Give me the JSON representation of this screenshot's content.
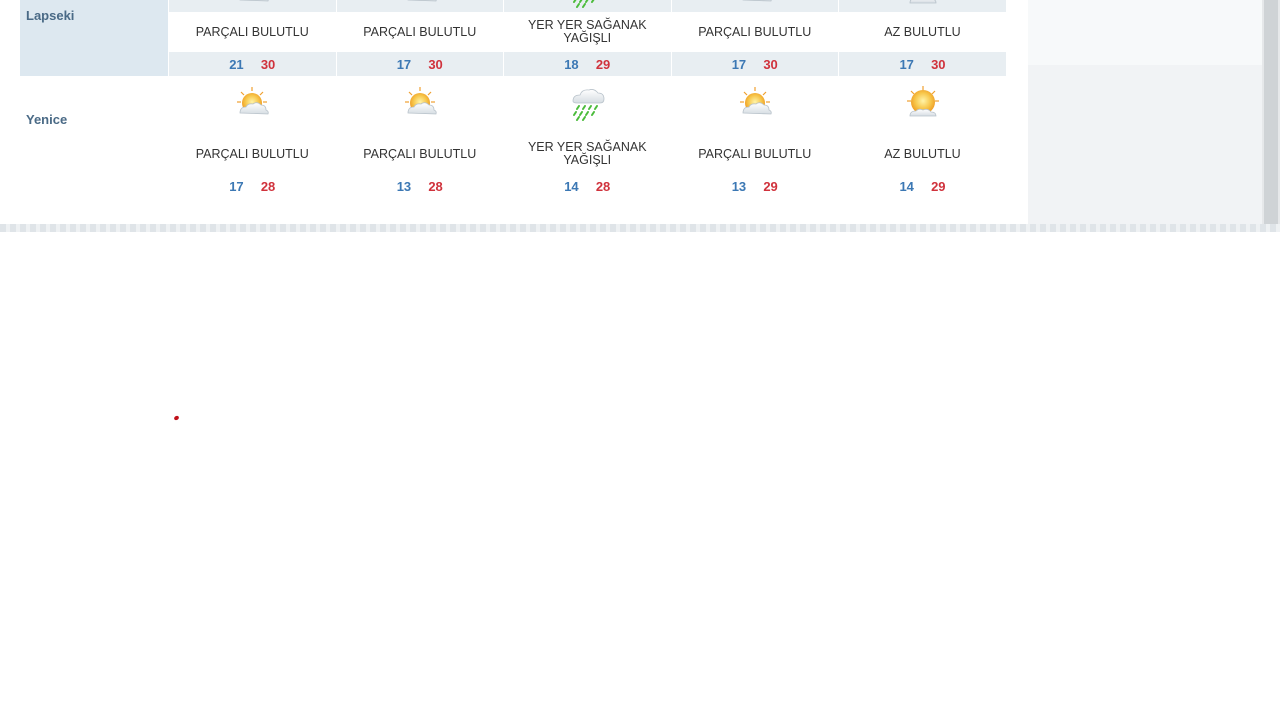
{
  "forecast": {
    "rows": [
      {
        "city": "Lapseki",
        "days": [
          {
            "icon": "partly-cloudy-icon",
            "condition": "PARÇALI BULUTLU",
            "min": "21",
            "max": "30"
          },
          {
            "icon": "partly-cloudy-icon",
            "condition": "PARÇALI BULUTLU",
            "min": "17",
            "max": "30"
          },
          {
            "icon": "rain-showers-icon",
            "condition": "YER YER SAĞANAK YAĞIŞLI",
            "min": "18",
            "max": "29"
          },
          {
            "icon": "partly-cloudy-icon",
            "condition": "PARÇALI BULUTLU",
            "min": "17",
            "max": "30"
          },
          {
            "icon": "mostly-sunny-icon",
            "condition": "AZ BULUTLU",
            "min": "17",
            "max": "30"
          }
        ]
      },
      {
        "city": "Yenice",
        "days": [
          {
            "icon": "partly-cloudy-icon",
            "condition": "PARÇALI BULUTLU",
            "min": "17",
            "max": "28"
          },
          {
            "icon": "partly-cloudy-icon",
            "condition": "PARÇALI BULUTLU",
            "min": "13",
            "max": "28"
          },
          {
            "icon": "rain-showers-icon",
            "condition": "YER YER SAĞANAK YAĞIŞLI",
            "min": "14",
            "max": "28"
          },
          {
            "icon": "partly-cloudy-icon",
            "condition": "PARÇALI BULUTLU",
            "min": "13",
            "max": "29"
          },
          {
            "icon": "mostly-sunny-icon",
            "condition": "AZ BULUTLU",
            "min": "14",
            "max": "29"
          }
        ]
      }
    ]
  },
  "colors": {
    "city_text": "#4a6a86",
    "min_temp": "#3c78b4",
    "max_temp": "#d0323c",
    "row_shade": "#e8eef2",
    "city_shade": "#dde8f0"
  }
}
